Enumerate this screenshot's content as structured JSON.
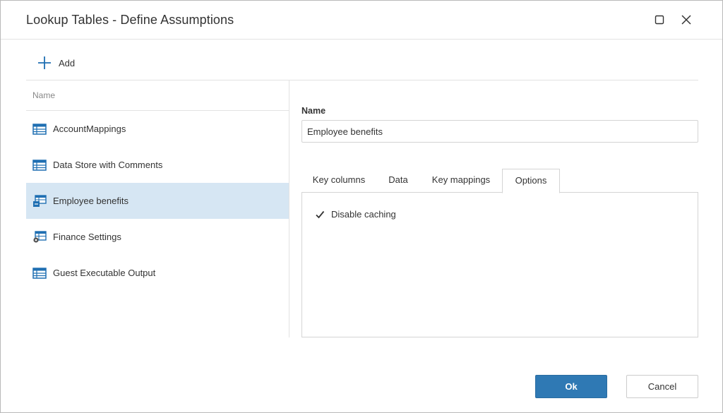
{
  "window": {
    "title": "Lookup Tables - Define Assumptions",
    "maximize_icon": "maximize-icon",
    "close_icon": "close-icon"
  },
  "toolbar": {
    "add_label": "Add",
    "add_icon": "plus-icon"
  },
  "list": {
    "header": "Name",
    "items": [
      {
        "label": "AccountMappings",
        "icon": "table-icon",
        "selected": false
      },
      {
        "label": "Data Store with Comments",
        "icon": "table-icon",
        "selected": false
      },
      {
        "label": "Employee benefits",
        "icon": "table-link-icon",
        "selected": true
      },
      {
        "label": "Finance Settings",
        "icon": "table-settings-icon",
        "selected": false
      },
      {
        "label": "Guest Executable Output",
        "icon": "table-icon",
        "selected": false
      }
    ]
  },
  "detail": {
    "name_label": "Name",
    "name_value": "Employee benefits",
    "tabs": [
      {
        "label": "Key columns",
        "active": false
      },
      {
        "label": "Data",
        "active": false
      },
      {
        "label": "Key mappings",
        "active": false
      },
      {
        "label": "Options",
        "active": true
      }
    ],
    "options": {
      "disable_caching_label": "Disable caching",
      "disable_caching_checked": true
    }
  },
  "footer": {
    "ok_label": "Ok",
    "cancel_label": "Cancel"
  },
  "colors": {
    "accent": "#2f79b4",
    "selected_row": "#d6e6f3",
    "icon_blue": "#1f6fb2"
  }
}
